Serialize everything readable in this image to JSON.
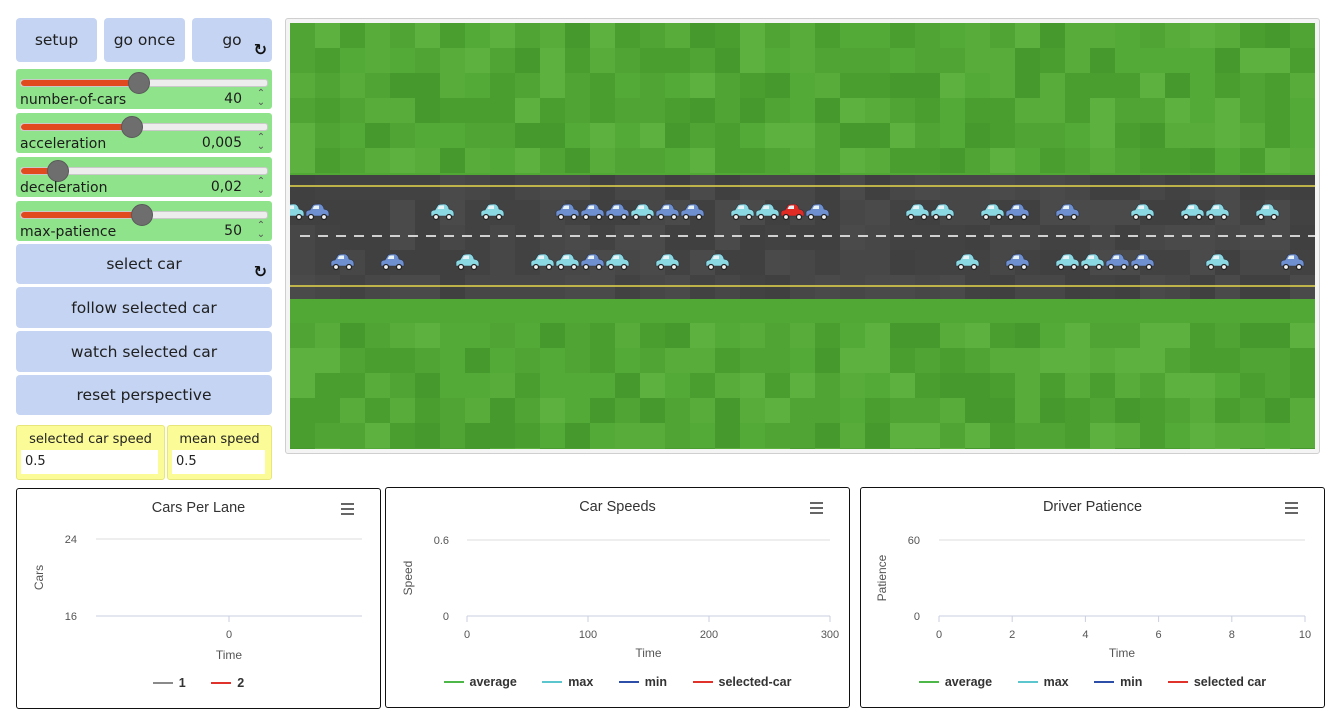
{
  "buttons": {
    "setup": "setup",
    "go_once": "go once",
    "go": "go",
    "select_car": "select car",
    "follow": "follow selected car",
    "watch": "watch selected car",
    "reset": "reset perspective"
  },
  "sliders": [
    {
      "label": "number-of-cars",
      "value": "40",
      "fraction": 0.48
    },
    {
      "label": "acceleration",
      "value": "0,005",
      "fraction": 0.45
    },
    {
      "label": "deceleration",
      "value": "0,02",
      "fraction": 0.15
    },
    {
      "label": "max-patience",
      "value": "50",
      "fraction": 0.49
    }
  ],
  "monitors": {
    "selected_car_speed_label": "selected car speed",
    "selected_car_speed_value": "0.5",
    "mean_speed_label": "mean speed",
    "mean_speed_value": "0.5"
  },
  "view": {
    "grass_color": "#52a835",
    "road_color": "#444444",
    "lane_line_color": "#e6d84a",
    "car_color_light": "#8ad8e2",
    "car_color_blue": "#6e8fd0",
    "selected_car_color": "#e02a24",
    "cars": [
      {
        "lane": 1,
        "x": 2,
        "color": "light"
      },
      {
        "lane": 1,
        "x": 27,
        "color": "blue"
      },
      {
        "lane": 1,
        "x": 152,
        "color": "light"
      },
      {
        "lane": 1,
        "x": 202,
        "color": "light"
      },
      {
        "lane": 1,
        "x": 277,
        "color": "blue"
      },
      {
        "lane": 1,
        "x": 302,
        "color": "blue"
      },
      {
        "lane": 1,
        "x": 327,
        "color": "blue"
      },
      {
        "lane": 1,
        "x": 352,
        "color": "light"
      },
      {
        "lane": 1,
        "x": 377,
        "color": "blue"
      },
      {
        "lane": 1,
        "x": 402,
        "color": "blue"
      },
      {
        "lane": 1,
        "x": 452,
        "color": "light"
      },
      {
        "lane": 1,
        "x": 477,
        "color": "light"
      },
      {
        "lane": 1,
        "x": 502,
        "color": "selected"
      },
      {
        "lane": 1,
        "x": 527,
        "color": "blue"
      },
      {
        "lane": 1,
        "x": 627,
        "color": "light"
      },
      {
        "lane": 1,
        "x": 652,
        "color": "light"
      },
      {
        "lane": 1,
        "x": 702,
        "color": "light"
      },
      {
        "lane": 1,
        "x": 727,
        "color": "blue"
      },
      {
        "lane": 1,
        "x": 777,
        "color": "blue"
      },
      {
        "lane": 1,
        "x": 852,
        "color": "light"
      },
      {
        "lane": 1,
        "x": 902,
        "color": "light"
      },
      {
        "lane": 1,
        "x": 927,
        "color": "light"
      },
      {
        "lane": 1,
        "x": 977,
        "color": "light"
      },
      {
        "lane": 2,
        "x": 52,
        "color": "blue"
      },
      {
        "lane": 2,
        "x": 102,
        "color": "blue"
      },
      {
        "lane": 2,
        "x": 177,
        "color": "light"
      },
      {
        "lane": 2,
        "x": 252,
        "color": "light"
      },
      {
        "lane": 2,
        "x": 277,
        "color": "light"
      },
      {
        "lane": 2,
        "x": 302,
        "color": "blue"
      },
      {
        "lane": 2,
        "x": 327,
        "color": "light"
      },
      {
        "lane": 2,
        "x": 377,
        "color": "light"
      },
      {
        "lane": 2,
        "x": 427,
        "color": "light"
      },
      {
        "lane": 2,
        "x": 677,
        "color": "light"
      },
      {
        "lane": 2,
        "x": 727,
        "color": "blue"
      },
      {
        "lane": 2,
        "x": 777,
        "color": "light"
      },
      {
        "lane": 2,
        "x": 802,
        "color": "light"
      },
      {
        "lane": 2,
        "x": 827,
        "color": "blue"
      },
      {
        "lane": 2,
        "x": 852,
        "color": "blue"
      },
      {
        "lane": 2,
        "x": 927,
        "color": "light"
      },
      {
        "lane": 2,
        "x": 1002,
        "color": "blue"
      }
    ]
  },
  "chart_data": [
    {
      "type": "line",
      "title": "Cars Per Lane",
      "xlabel": "Time",
      "ylabel": "Cars",
      "xlim": [
        0,
        0
      ],
      "ylim": [
        16,
        24
      ],
      "x_ticks": [
        "0"
      ],
      "y_ticks": [
        "24",
        "16"
      ],
      "grid": true,
      "legend_placement": "bottom",
      "series": [
        {
          "name": "1",
          "color": "#8a8a8a",
          "values": []
        },
        {
          "name": "2",
          "color": "#e0322b",
          "values": []
        }
      ]
    },
    {
      "type": "line",
      "title": "Car Speeds",
      "xlabel": "Time",
      "ylabel": "Speed",
      "xlim": [
        0,
        300
      ],
      "ylim": [
        0,
        0.6
      ],
      "x_ticks": [
        "0",
        "100",
        "200",
        "300"
      ],
      "y_ticks": [
        "0.6",
        "0"
      ],
      "grid": true,
      "legend_placement": "bottom",
      "series": [
        {
          "name": "average",
          "color": "#4db848",
          "values": []
        },
        {
          "name": "max",
          "color": "#5cc6cf",
          "values": []
        },
        {
          "name": "min",
          "color": "#2c4ea8",
          "values": []
        },
        {
          "name": "selected-car",
          "color": "#e0322b",
          "values": []
        }
      ]
    },
    {
      "type": "line",
      "title": "Driver Patience",
      "xlabel": "Time",
      "ylabel": "Patience",
      "xlim": [
        0,
        10
      ],
      "ylim": [
        0,
        60
      ],
      "x_ticks": [
        "0",
        "2",
        "4",
        "6",
        "8",
        "10"
      ],
      "y_ticks": [
        "60",
        "0"
      ],
      "grid": true,
      "legend_placement": "bottom",
      "series": [
        {
          "name": "average",
          "color": "#4db848",
          "values": []
        },
        {
          "name": "max",
          "color": "#5cc6cf",
          "values": []
        },
        {
          "name": "min",
          "color": "#2c4ea8",
          "values": []
        },
        {
          "name": "selected car",
          "color": "#e0322b",
          "values": []
        }
      ]
    }
  ]
}
